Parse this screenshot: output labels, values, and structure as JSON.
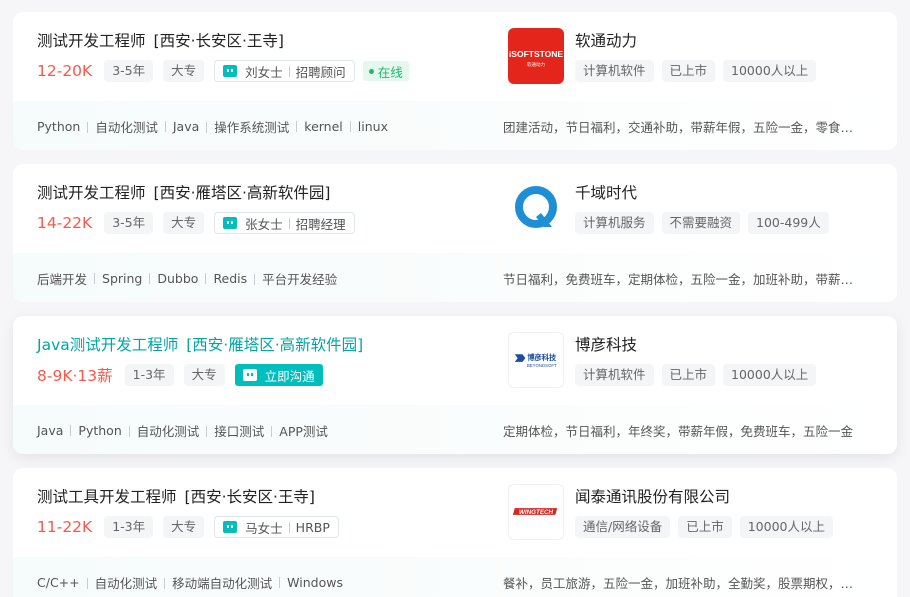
{
  "jobs": [
    {
      "title": "测试开发工程师",
      "area": "[西安·长安区·王寺]",
      "salary": "12-20K",
      "experience": "3-5年",
      "education": "大专",
      "recruiter_name": "刘女士",
      "recruiter_role": "招聘顾问",
      "status": "在线",
      "skills": [
        "Python",
        "自动化测试",
        "Java",
        "操作系统测试",
        "kernel",
        "linux"
      ],
      "company": "软通动力",
      "logo_text": "iSOFTSTONE",
      "logo_subtext": "软通动力",
      "company_tags": [
        "计算机软件",
        "已上市",
        "10000人以上"
      ],
      "benefits": "团建活动，节日福利，交通补助，带薪年假，五险一金，零食下午茶，定期体检"
    },
    {
      "title": "测试开发工程师",
      "area": "[西安·雁塔区·高新软件园]",
      "salary": "14-22K",
      "experience": "3-5年",
      "education": "大专",
      "recruiter_name": "张女士",
      "recruiter_role": "招聘经理",
      "skills": [
        "后端开发",
        "Spring",
        "Dubbo",
        "Redis",
        "平台开发经验"
      ],
      "company": "千域时代",
      "company_tags": [
        "计算机服务",
        "不需要融资",
        "100-499人"
      ],
      "benefits": "节日福利，免费班车，定期体检，五险一金，加班补助，带薪年假"
    },
    {
      "title": "Java测试开发工程师",
      "area": "[西安·雁塔区·高新软件园]",
      "salary": "8-9K·13薪",
      "experience": "1-3年",
      "education": "大专",
      "chat_label": "立即沟通",
      "skills": [
        "Java",
        "Python",
        "自动化测试",
        "接口测试",
        "APP测试"
      ],
      "company": "博彦科技",
      "logo_text": "博彦科技",
      "logo_subtext": "BEYONDSOFT",
      "company_tags": [
        "计算机软件",
        "已上市",
        "10000人以上"
      ],
      "benefits": "定期体检，节日福利，年终奖，带薪年假，免费班车，五险一金"
    },
    {
      "title": "测试工具开发工程师",
      "area": "[西安·长安区·王寺]",
      "salary": "11-22K",
      "experience": "1-3年",
      "education": "大专",
      "recruiter_name": "马女士",
      "recruiter_role": "HRBP",
      "skills": [
        "C/C++",
        "自动化测试",
        "移动端自动化测试",
        "Windows"
      ],
      "company": "闻泰通讯股份有限公司",
      "logo_text": "WINGTECH",
      "company_tags": [
        "通信/网络设备",
        "已上市",
        "10000人以上"
      ],
      "benefits": "餐补，员工旅游，五险一金，加班补助，全勤奖，股票期权，定期体检"
    }
  ],
  "colors": {
    "accent": "#00bebd",
    "salary": "#fe574a",
    "online": "#1fb96b",
    "softstone_red": "#e3251b",
    "qianyu_blue": "#1e8fd6"
  }
}
